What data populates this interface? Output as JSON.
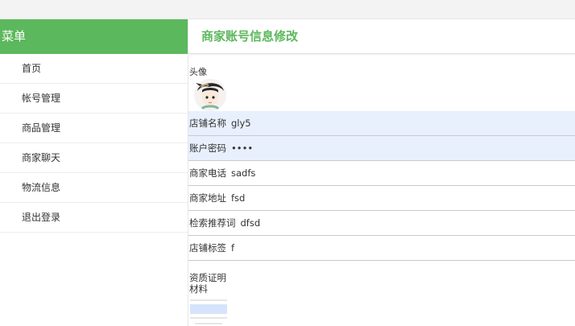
{
  "sidebar": {
    "title": "菜单",
    "items": [
      {
        "label": "首页"
      },
      {
        "label": "帐号管理"
      },
      {
        "label": "商品管理"
      },
      {
        "label": "商家聊天"
      },
      {
        "label": "物流信息"
      },
      {
        "label": "退出登录"
      }
    ]
  },
  "main": {
    "title": "商家账号信息修改",
    "avatar_label": "头像",
    "fields": [
      {
        "label": "店铺名称",
        "value": "gly5"
      },
      {
        "label": "账户密码",
        "value": "••••"
      },
      {
        "label": "商家电话",
        "value": "sadfs"
      },
      {
        "label": "商家地址",
        "value": "fsd"
      },
      {
        "label": "检索推荐词",
        "value": "dfsd"
      },
      {
        "label": "店铺标签",
        "value": "f"
      }
    ],
    "cert_label": "资质证明材料"
  },
  "colors": {
    "accent": "#5cb85c",
    "autofill_bg": "#e8f0fe"
  }
}
